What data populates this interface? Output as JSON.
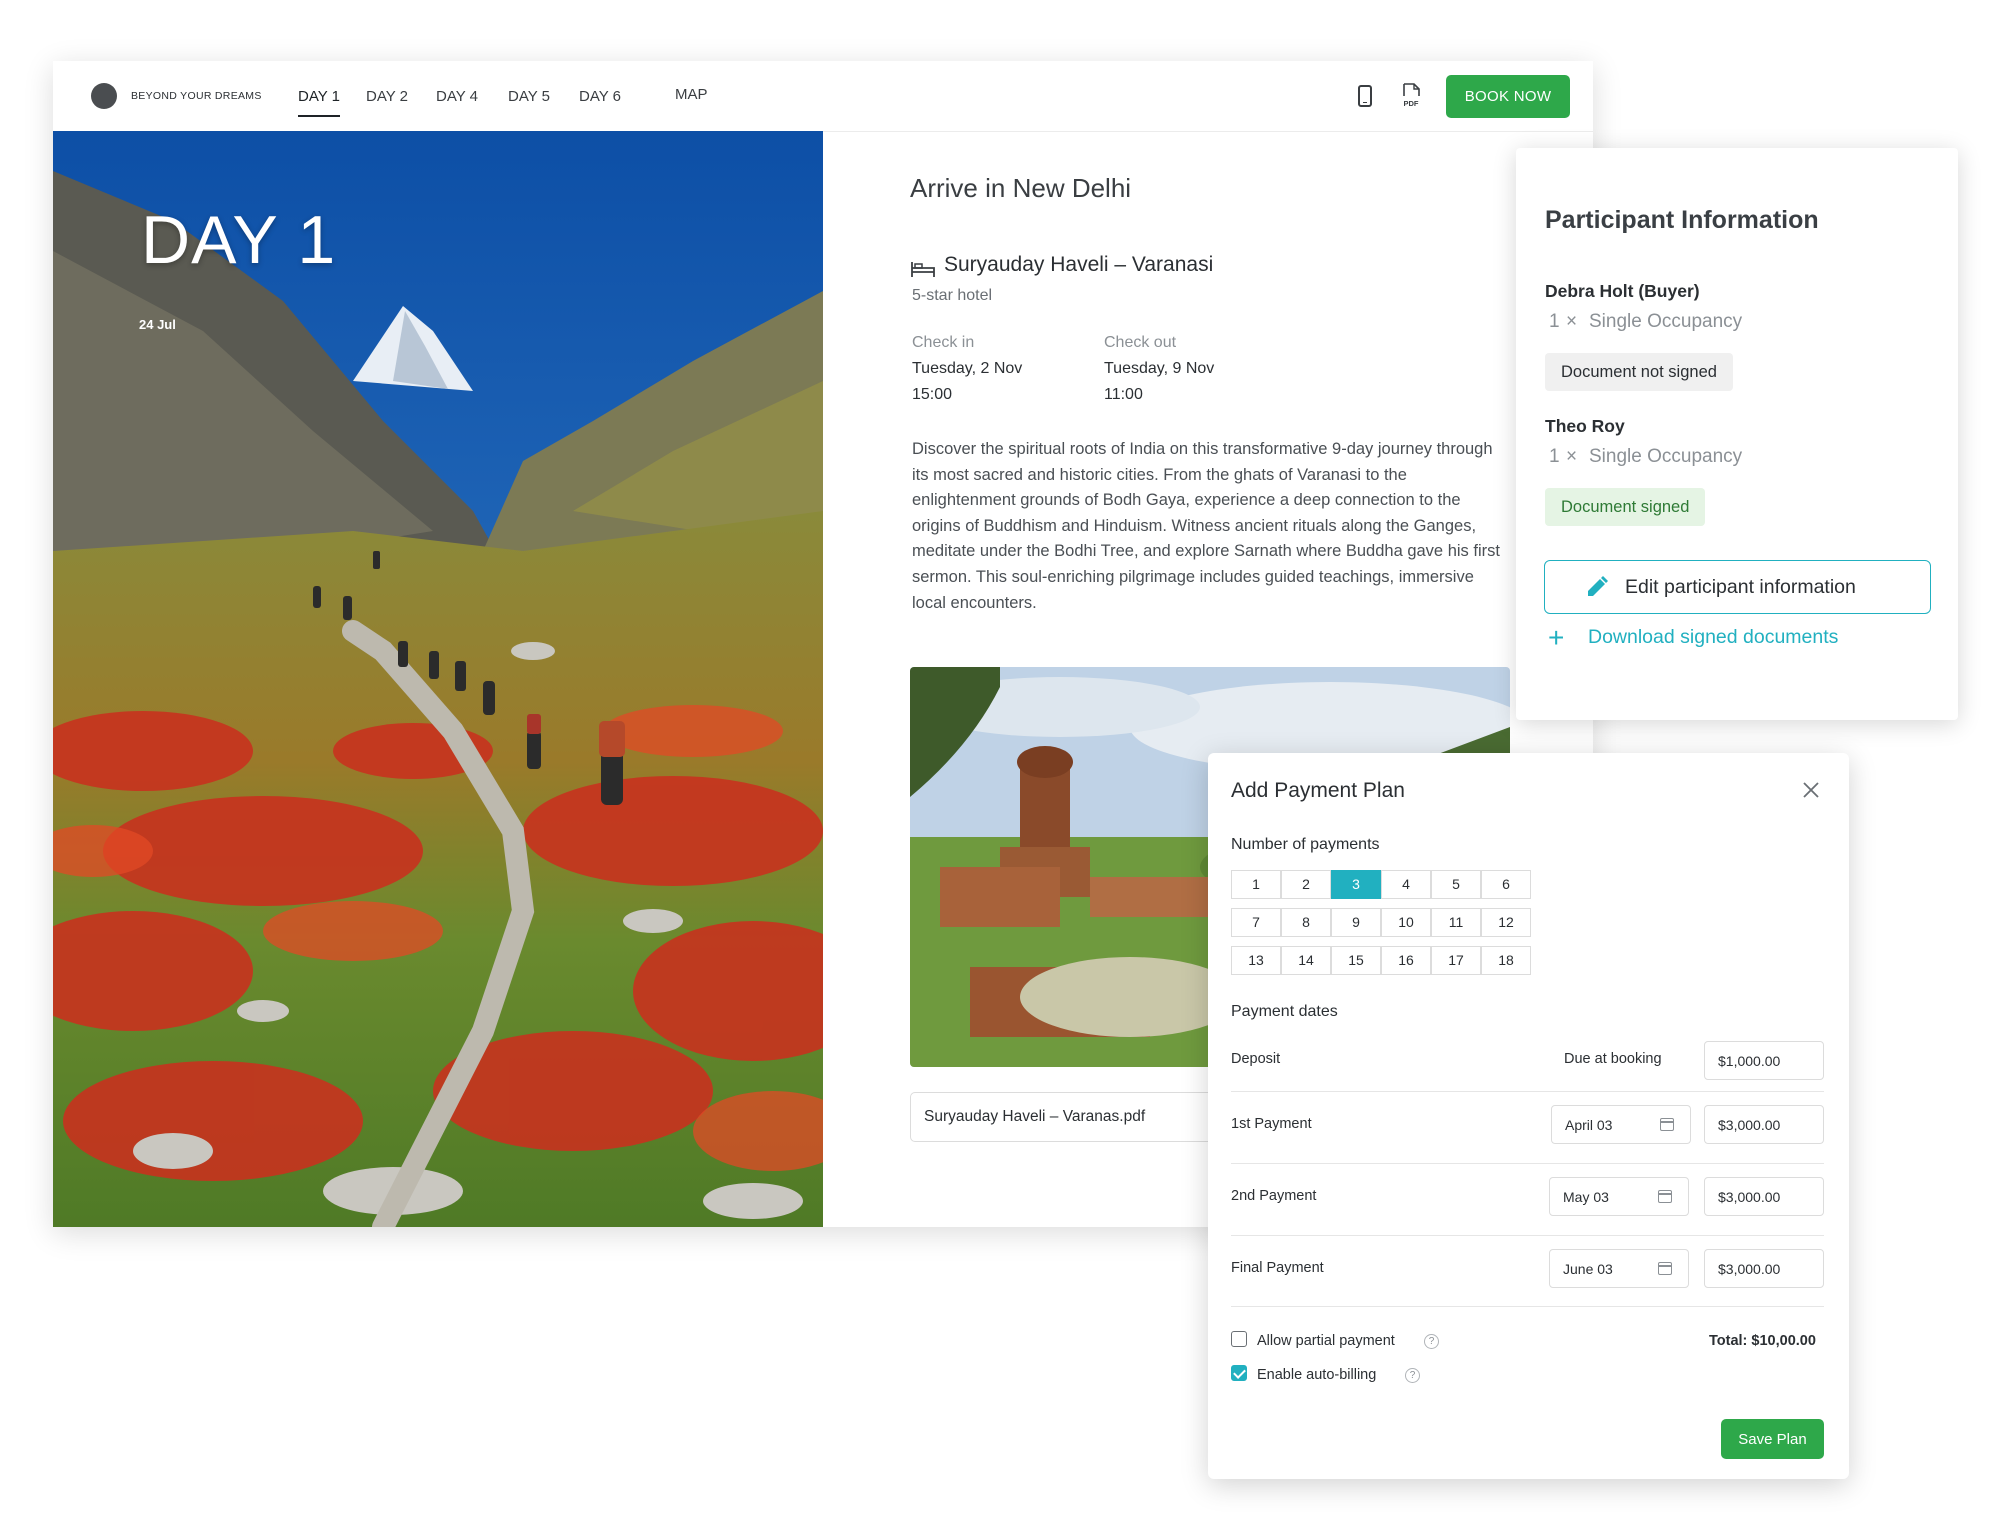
{
  "header": {
    "brand": "BEYOND YOUR DREAMS",
    "tabs": [
      "DAY 1",
      "DAY 2",
      "DAY 4",
      "DAY 5",
      "DAY 6",
      "MAP"
    ],
    "active_tab": "DAY 1",
    "phone_icon": "phone-icon",
    "pdf_icon": "pdf-icon",
    "pdf_icon_text": "PDF",
    "book_label": "BOOK NOW",
    "book_color": "#2ea84a"
  },
  "hero": {
    "day_title": "DAY 1",
    "date": "24 Jul"
  },
  "content": {
    "title": "Arrive in New Delhi",
    "hotel_name": "Suryauday Haveli – Varanasi",
    "hotel_rating": "5-star hotel",
    "check_in_label": "Check in",
    "check_in_date": "Tuesday, 2 Nov",
    "check_in_time": "15:00",
    "check_out_label": "Check out",
    "check_out_date": "Tuesday, 9 Nov",
    "check_out_time": "11:00",
    "description": "Discover the spiritual roots of India on this transformative 9-day journey through its most sacred and historic cities. From the ghats of Varanasi to the enlightenment grounds of Bodh Gaya, experience a deep connection to the origins of Buddhism and Hinduism. Witness ancient rituals along the Ganges, meditate under the Bodhi Tree, and explore Sarnath where Buddha gave his first sermon. This soul-enriching pilgrimage includes guided teachings, immersive local encounters.",
    "pdf_name": "Suryauday Haveli – Varanas.pdf"
  },
  "participants": {
    "title": "Participant Information",
    "people": [
      {
        "name": "Debra Holt (Buyer)",
        "qty": "1",
        "times": "×",
        "room": "Single Occupancy",
        "status": "Document not signed"
      },
      {
        "name": "Theo Roy",
        "qty": "1",
        "times": "×",
        "room": "Single Occupancy",
        "status": "Document signed"
      }
    ],
    "edit_label": "Edit participant information",
    "download_label": "Download signed documents",
    "accent": "#21b0c0"
  },
  "payment": {
    "title": "Add Payment Plan",
    "num_label": "Number of payments",
    "numbers": [
      "1",
      "2",
      "3",
      "4",
      "5",
      "6",
      "7",
      "8",
      "9",
      "10",
      "11",
      "12",
      "13",
      "14",
      "15",
      "16",
      "17",
      "18"
    ],
    "selected": "3",
    "dates_label": "Payment dates",
    "rows": [
      {
        "label": "Deposit",
        "due": "Due at booking",
        "date": "",
        "amount": "$1,000.00"
      },
      {
        "label": "1st Payment",
        "due": "",
        "date": "April 03",
        "amount": "$3,000.00"
      },
      {
        "label": "2nd Payment",
        "due": "",
        "date": "May 03",
        "amount": "$3,000.00"
      },
      {
        "label": "Final Payment",
        "due": "",
        "date": "June 03",
        "amount": "$3,000.00"
      }
    ],
    "partial_label": "Allow partial payment",
    "partial_checked": false,
    "autobill_label": "Enable auto-billing",
    "autobill_checked": true,
    "help_glyph": "?",
    "total": "Total: $10,00.00",
    "save_label": "Save Plan"
  }
}
